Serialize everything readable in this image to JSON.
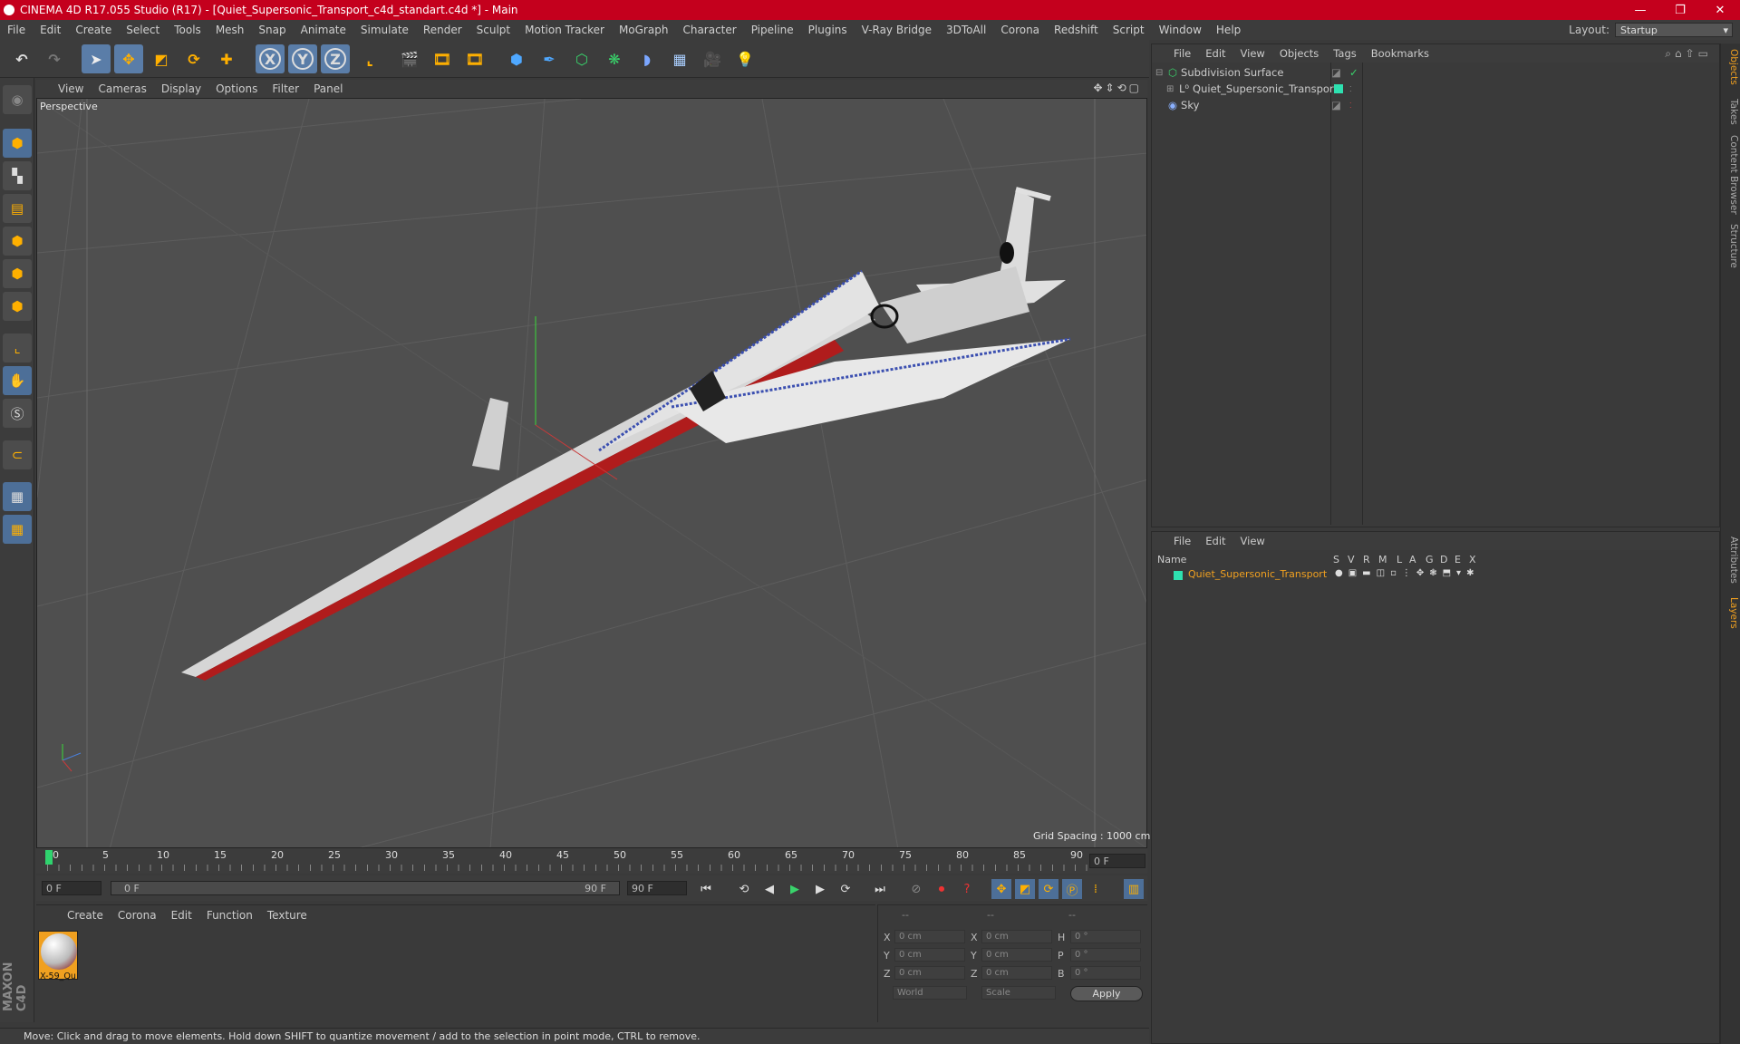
{
  "window": {
    "title": "CINEMA 4D R17.055 Studio (R17) - [Quiet_Supersonic_Transport_c4d_standart.c4d *] - Main",
    "minimize": "—",
    "restore": "❐",
    "close": "✕"
  },
  "menu": {
    "items": [
      "File",
      "Edit",
      "Create",
      "Select",
      "Tools",
      "Mesh",
      "Snap",
      "Animate",
      "Simulate",
      "Render",
      "Sculpt",
      "Motion Tracker",
      "MoGraph",
      "Character",
      "Pipeline",
      "Plugins",
      "V-Ray Bridge",
      "3DToAll",
      "Corona",
      "Redshift",
      "Script",
      "Window",
      "Help"
    ],
    "layout_label": "Layout:",
    "layout_value": "Startup"
  },
  "toolbar": {
    "icons": [
      "undo-icon",
      "redo-icon",
      "select-arrow-icon",
      "move-icon",
      "scale-icon",
      "rotate-icon",
      "add-icon",
      "x-axis-icon",
      "y-axis-icon",
      "z-axis-icon",
      "coord-system-icon",
      "render-view-icon",
      "render-picture-viewer-icon",
      "render-settings-icon",
      "cube-primitive-icon",
      "pen-spline-icon",
      "subdivision-icon",
      "cloner-icon",
      "deformer-icon",
      "floor-icon",
      "camera-icon",
      "light-icon"
    ],
    "axis_x": "X",
    "axis_y": "Y",
    "axis_z": "Z"
  },
  "viewport": {
    "menu": [
      "View",
      "Cameras",
      "Display",
      "Options",
      "Filter",
      "Panel"
    ],
    "label": "Perspective",
    "grid_spacing": "Grid Spacing : 1000 cm"
  },
  "timeline": {
    "ticks": [
      "0",
      "5",
      "10",
      "15",
      "20",
      "25",
      "30",
      "35",
      "40",
      "45",
      "50",
      "55",
      "60",
      "65",
      "70",
      "75",
      "80",
      "85",
      "90"
    ],
    "current_frame_field": "0 F"
  },
  "playback": {
    "start": "0 F",
    "range_start": "0 F",
    "range_end": "90 F",
    "end": "90 F"
  },
  "materials": {
    "menu": [
      "Create",
      "Corona",
      "Edit",
      "Function",
      "Texture"
    ],
    "items": [
      {
        "name": "X-59_Qu"
      }
    ]
  },
  "coords": {
    "header": [
      "--",
      "--",
      "--"
    ],
    "rows": [
      {
        "a": "X",
        "v1": "0 cm",
        "b": "X",
        "v2": "0 cm",
        "c": "H",
        "v3": "0 °"
      },
      {
        "a": "Y",
        "v1": "0 cm",
        "b": "Y",
        "v2": "0 cm",
        "c": "P",
        "v3": "0 °"
      },
      {
        "a": "Z",
        "v1": "0 cm",
        "b": "Z",
        "v2": "0 cm",
        "c": "B",
        "v3": "0 °"
      }
    ],
    "space": "World",
    "mode": "Scale",
    "apply": "Apply"
  },
  "status": "Move: Click and drag to move elements. Hold down SHIFT to quantize movement / add to the selection in point mode, CTRL to remove.",
  "objects": {
    "menu": [
      "File",
      "Edit",
      "View",
      "Objects",
      "Tags",
      "Bookmarks"
    ],
    "rows": [
      {
        "name": "Subdivision Surface",
        "tag_color": "#9ad14e"
      },
      {
        "name": "Quiet_Supersonic_Transport",
        "tag_color": "#2ee0b0"
      },
      {
        "name": "Sky",
        "tag_color": ""
      }
    ]
  },
  "layers": {
    "menu": [
      "File",
      "Edit",
      "View"
    ],
    "columns": [
      "Name",
      "S",
      "V",
      "R",
      "M",
      "L",
      "A",
      "G",
      "D",
      "E",
      "X"
    ],
    "rows": [
      {
        "name": "Quiet_Supersonic_Transport",
        "color": "#2ee0b0"
      }
    ]
  },
  "right_tabs": [
    "Objects",
    "Takes",
    "Content Browser",
    "Structure",
    "Attributes",
    "Layers"
  ],
  "colors": {
    "title_bar": "#c4001d",
    "accent": "#5a7da8",
    "layer_name": "#f0a020"
  }
}
